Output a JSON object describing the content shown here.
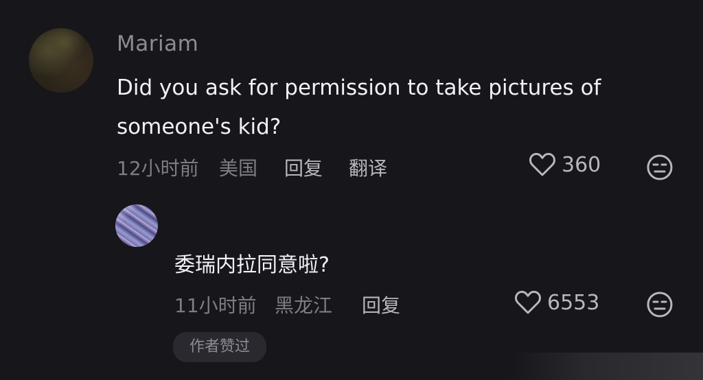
{
  "comment": {
    "username": "Mariam",
    "text": "Did you ask for permission to take pictures of someone's kid?",
    "time": "12小时前",
    "location": "美国",
    "reply_label": "回复",
    "translate_label": "翻译",
    "likes": "360"
  },
  "reply": {
    "text": "委瑞内拉同意啦?",
    "time": "11小时前",
    "location": "黑龙江",
    "reply_label": "回复",
    "likes": "6553",
    "author_badge": "作者赞过"
  },
  "icons": {
    "like": "heart-outline-icon",
    "dislike": "neutral-face-icon"
  },
  "colors": {
    "background": "#17161b",
    "primary_text": "#f2f1f5",
    "secondary_text": "#7e7d84",
    "action_text": "#b8b7be"
  }
}
